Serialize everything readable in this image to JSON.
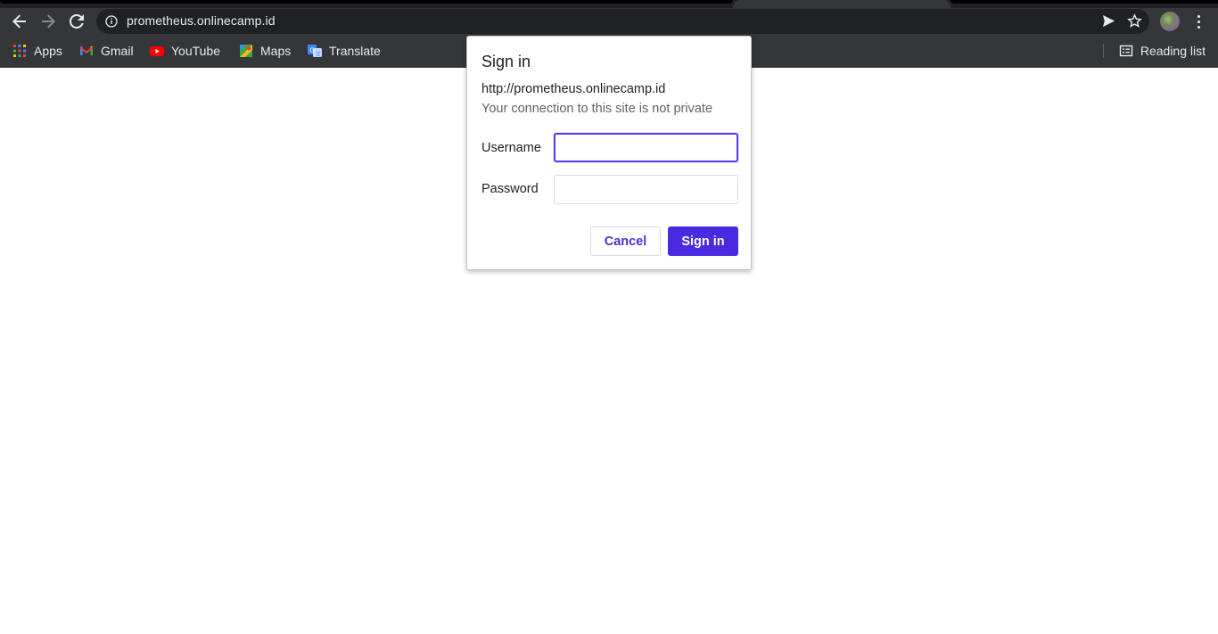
{
  "browser": {
    "url": "prometheus.onlinecamp.id",
    "nav": {
      "back_icon": "arrow-left-icon",
      "forward_icon": "arrow-right-icon",
      "reload_icon": "reload-icon"
    }
  },
  "bookmarks": {
    "items": [
      {
        "label": "Apps",
        "icon": "apps-grid-icon"
      },
      {
        "label": "Gmail",
        "icon": "gmail-icon"
      },
      {
        "label": "YouTube",
        "icon": "youtube-icon"
      },
      {
        "label": "Maps",
        "icon": "maps-icon"
      },
      {
        "label": "Translate",
        "icon": "translate-icon"
      }
    ],
    "reading_list": "Reading list"
  },
  "dialog": {
    "title": "Sign in",
    "origin": "http://prometheus.onlinecamp.id",
    "warning": "Your connection to this site is not private",
    "username_label": "Username",
    "username_value": "",
    "password_label": "Password",
    "password_value": "",
    "cancel_label": "Cancel",
    "signin_label": "Sign in"
  },
  "colors": {
    "accent": "#4a2ae0",
    "chrome_bg": "#35363a",
    "omnibox_bg": "#202124"
  }
}
